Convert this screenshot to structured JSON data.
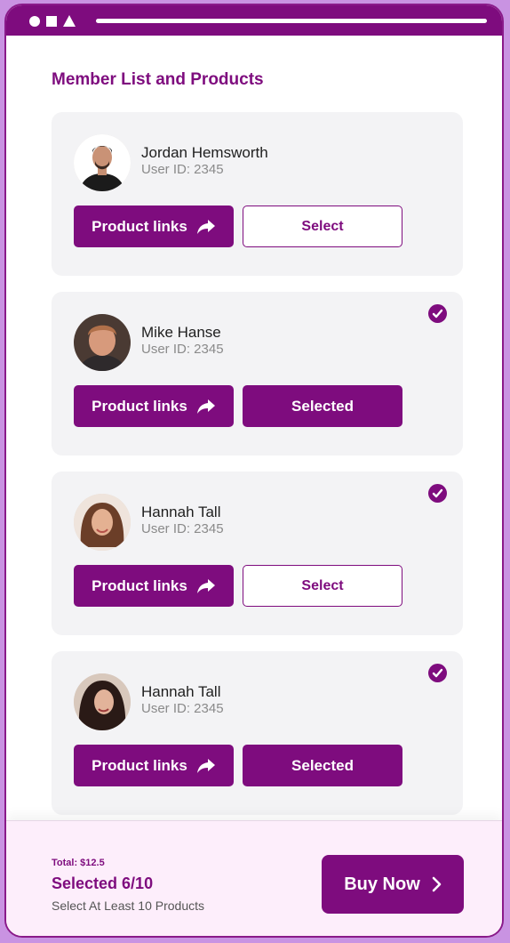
{
  "window": {
    "controls": [
      "circle-icon",
      "square-icon",
      "triangle-icon"
    ]
  },
  "page": {
    "title": "Member List and Products"
  },
  "members": [
    {
      "name": "Jordan Hemsworth",
      "user_id": "User ID: 2345",
      "selected": false,
      "links_label": "Product links",
      "action_label": "Select"
    },
    {
      "name": "Mike Hanse",
      "user_id": "User ID: 2345",
      "selected": true,
      "links_label": "Product links",
      "action_label": "Selected"
    },
    {
      "name": "Hannah Tall",
      "user_id": "User ID: 2345",
      "selected": true,
      "links_label": "Product links",
      "action_label": "Select"
    },
    {
      "name": "Hannah Tall",
      "user_id": "User ID: 2345",
      "selected": true,
      "links_label": "Product links",
      "action_label": "Selected"
    }
  ],
  "footer": {
    "total": "Total: $12.5",
    "selected_count": "Selected 6/10",
    "hint": "Select At Least 10 Products",
    "buy_label": "Buy Now"
  },
  "colors": {
    "accent": "#7e0c7e",
    "outer_background": "#c993e2",
    "card_background": "#f3f3f5",
    "footer_background": "#fdeefb"
  }
}
